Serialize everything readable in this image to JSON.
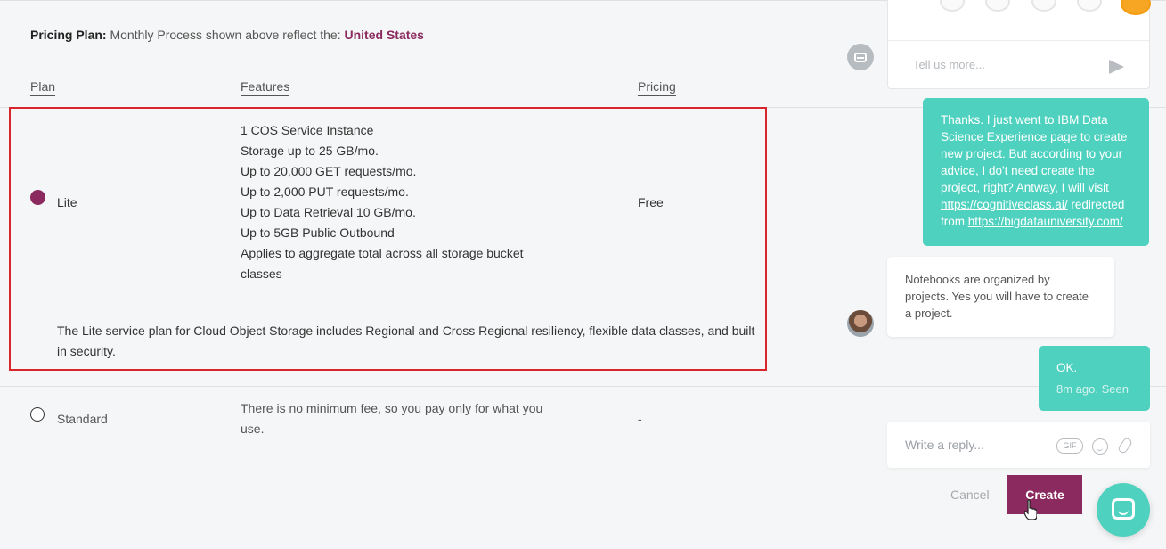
{
  "pricing": {
    "label": "Pricing Plan:",
    "text": "Monthly Process shown above reflect the:",
    "country": "United States"
  },
  "columns": {
    "plan": "Plan",
    "features": "Features",
    "pricing": "Pricing"
  },
  "plans": [
    {
      "name": "Lite",
      "selected": true,
      "features": [
        "1 COS Service Instance",
        "Storage up to 25 GB/mo.",
        "Up to 20,000 GET requests/mo.",
        "Up to 2,000 PUT requests/mo.",
        "Up to Data Retrieval 10 GB/mo.",
        "Up to 5GB Public Outbound",
        "Applies to aggregate total across all storage bucket classes"
      ],
      "price": "Free",
      "description": "The Lite service plan for Cloud Object Storage includes Regional and Cross Regional resiliency, flexible data classes, and built in security."
    },
    {
      "name": "Standard",
      "selected": false,
      "features": [
        "There is no minimum fee, so you pay only for what you use."
      ],
      "price": "-"
    }
  ],
  "chat": {
    "feedback_placeholder": "Tell us more...",
    "user_message": {
      "text_before": "Thanks. I just went to IBM Data Science Experience page to create new project. But according to your advice, I do't need create the project, right? Antway, I will visit",
      "link1": "https://cognitiveclass.ai/",
      "middle": "redirected from",
      "link2": "https://bigdatauniversity.com/"
    },
    "agent_message": "Notebooks are organized by projects.  Yes you will have to create a project.",
    "user_reply": {
      "text": "OK.",
      "meta": "8m ago. Seen"
    },
    "reply_placeholder": "Write a reply...",
    "gif_label": "GIF"
  },
  "actions": {
    "cancel": "Cancel",
    "create": "Create"
  },
  "colors": {
    "accent": "#8a2a5e",
    "chat": "#4fd1bf",
    "highlight": "#d9262e"
  }
}
